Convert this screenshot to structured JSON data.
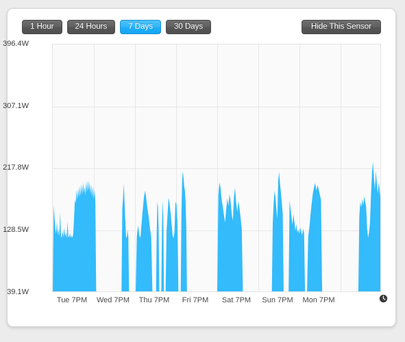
{
  "panel": {
    "name": "sensor-graph-panel"
  },
  "toolbar": {
    "range_buttons": [
      {
        "label": "1 Hour",
        "active": false
      },
      {
        "label": "24 Hours",
        "active": false
      },
      {
        "label": "7 Days",
        "active": true
      },
      {
        "label": "30 Days",
        "active": false
      }
    ],
    "hide_sensor_label": "Hide This Sensor",
    "active_color": "#2cb4f7",
    "inactive_color": "#5b5b5b"
  },
  "chart_data": {
    "type": "area",
    "title": "",
    "xlabel": "",
    "ylabel": "",
    "unit": "W",
    "series_color": "#33bbfb",
    "grid": true,
    "legend": "none",
    "ylim": [
      39.1,
      396.4
    ],
    "ytick_labels": [
      "396.4W",
      "307.1W",
      "217.8W",
      "128.5W",
      "39.1W"
    ],
    "ytick_values": [
      396.4,
      307.1,
      217.8,
      128.5,
      39.1
    ],
    "xtick_labels": [
      "Tue 7PM",
      "Wed 7PM",
      "Thu 7PM",
      "Fri 7PM",
      "Sat 7PM",
      "Sun 7PM",
      "Mon 7PM"
    ],
    "x_range": "7 days",
    "baseline": 39.1,
    "max_observed": 228.0,
    "segments": [
      {
        "start_frac": 0.0,
        "end_frac": 0.132,
        "values": [
          39.1,
          165.0,
          150.0,
          132.0,
          124.0,
          141.0,
          122.0,
          131.0,
          120.0,
          155.0,
          121.0,
          118.0,
          128.0,
          119.0,
          133.0,
          120.0,
          126.0,
          117.0,
          142.0,
          120.0,
          119.0,
          125.0,
          118.0,
          122.0,
          118.0,
          124.0,
          146.0,
          173.0,
          168.0,
          187.0,
          172.0,
          190.0,
          176.0,
          193.0,
          178.0,
          196.0,
          180.0,
          198.0,
          183.0,
          192.0,
          179.0,
          200.0,
          184.0,
          201.0,
          186.0,
          199.0,
          181.0,
          195.0,
          177.0,
          192.0,
          174.0,
          188.0,
          170.0,
          39.1
        ]
      },
      {
        "start_frac": 0.209,
        "end_frac": 0.232,
        "values": [
          39.1,
          160.0,
          175.0,
          196.0,
          169.0,
          144.0,
          120.0,
          118.0,
          130.0,
          119.0,
          39.1
        ]
      },
      {
        "start_frac": 0.252,
        "end_frac": 0.303,
        "values": [
          39.1,
          120.0,
          136.0,
          122.0,
          118.0,
          140.0,
          160.0,
          178.0,
          186.0,
          172.0,
          158.0,
          147.0,
          131.0,
          119.0,
          39.1
        ]
      },
      {
        "start_frac": 0.314,
        "end_frac": 0.324,
        "values": [
          39.1,
          125.0,
          170.0,
          162.0,
          128.0,
          39.1
        ]
      },
      {
        "start_frac": 0.33,
        "end_frac": 0.338,
        "values": [
          39.1,
          135.0,
          172.0,
          150.0,
          39.1
        ]
      },
      {
        "start_frac": 0.343,
        "end_frac": 0.382,
        "values": [
          39.1,
          128.0,
          152.0,
          176.0,
          168.0,
          155.0,
          140.0,
          123.0,
          117.0,
          126.0,
          170.0,
          166.0,
          143.0,
          39.1
        ]
      },
      {
        "start_frac": 0.389,
        "end_frac": 0.408,
        "values": [
          39.1,
          150.0,
          199.0,
          214.0,
          205.0,
          192.0,
          186.0,
          171.0,
          133.0,
          39.1
        ]
      },
      {
        "start_frac": 0.5,
        "end_frac": 0.578,
        "values": [
          39.1,
          180.0,
          198.0,
          190.0,
          172.0,
          163.0,
          151.0,
          140.0,
          158.0,
          175.0,
          164.0,
          181.0,
          170.0,
          152.0,
          143.0,
          177.0,
          190.0,
          168.0,
          155.0,
          171.0,
          160.0,
          146.0,
          131.0,
          39.1
        ]
      },
      {
        "start_frac": 0.666,
        "end_frac": 0.702,
        "values": [
          39.1,
          140.0,
          168.0,
          186.0,
          176.0,
          160.0,
          145.0,
          200.0,
          213.0,
          196.0,
          183.0,
          168.0,
          152.0,
          39.1
        ]
      },
      {
        "start_frac": 0.717,
        "end_frac": 0.767,
        "values": [
          39.1,
          172.0,
          160.0,
          148.0,
          137.0,
          152.0,
          141.0,
          128.0,
          138.0,
          126.0,
          130.0,
          124.0,
          133.0,
          127.0,
          122.0,
          131.0,
          125.0,
          39.1
        ]
      },
      {
        "start_frac": 0.773,
        "end_frac": 0.819,
        "values": [
          39.1,
          120.0,
          133.0,
          151.0,
          168.0,
          182.0,
          191.0,
          197.0,
          186.0,
          194.0,
          188.0,
          180.0,
          173.0,
          39.1
        ]
      },
      {
        "start_frac": 0.929,
        "end_frac": 1.0,
        "values": [
          39.1,
          150.0,
          170.0,
          162.0,
          174.0,
          165.0,
          178.0,
          170.0,
          163.0,
          132.0,
          118.0,
          126.0,
          140.0,
          180.0,
          210.0,
          228.0,
          205.0,
          188.0,
          214.0,
          196.0,
          182.0,
          198.0,
          185.0,
          172.0,
          39.1
        ]
      }
    ]
  },
  "footer": {
    "clock_icon": "clock-icon"
  }
}
